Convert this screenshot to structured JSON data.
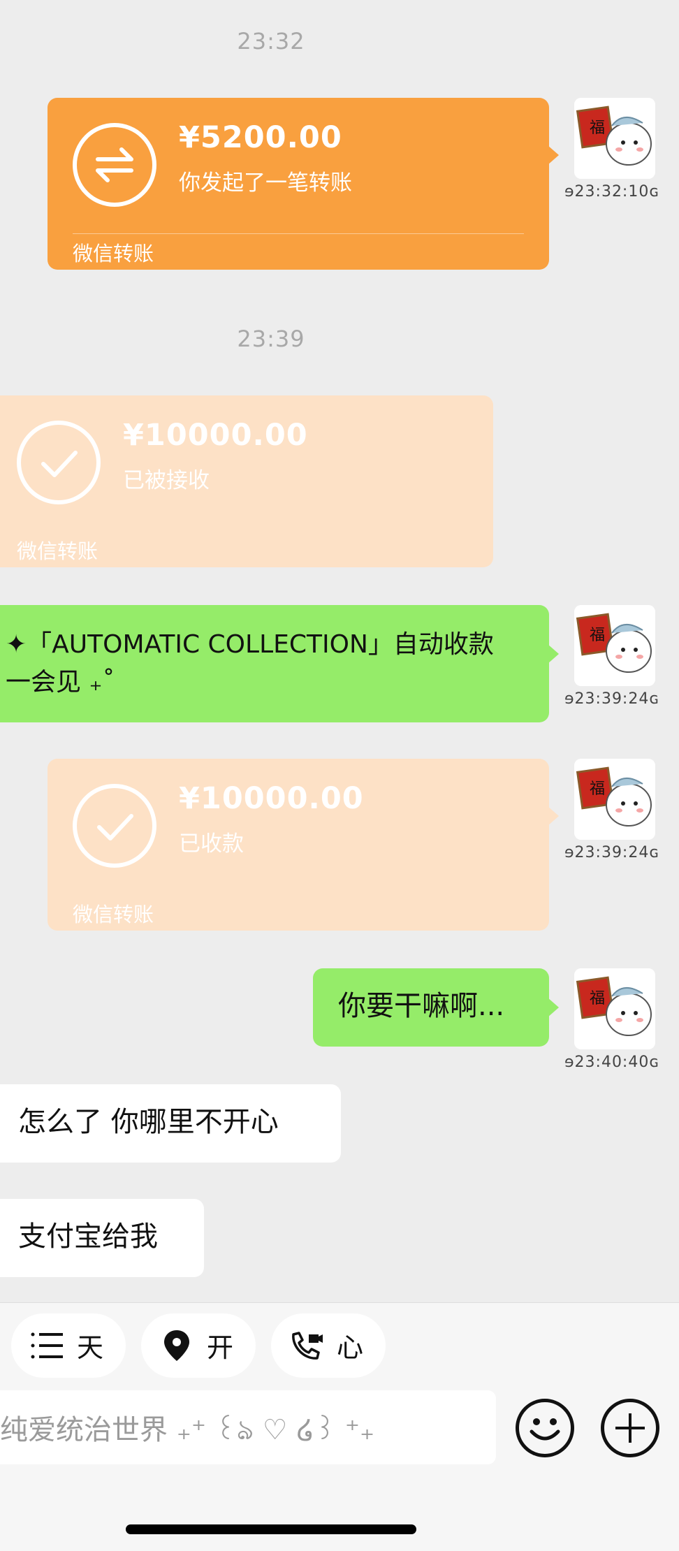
{
  "messages": {
    "time1": "23:32",
    "transfer1": {
      "amount": "¥5200.00",
      "status": "你发起了一笔转账",
      "footer": "微信转账",
      "icon": "transfer-arrows-icon"
    },
    "stamp1": "ɘ23:32:10ɢ",
    "time2": "23:39",
    "transfer2": {
      "amount": "¥10000.00",
      "status": "已被接收",
      "footer": "微信转账",
      "icon": "check-circle-icon"
    },
    "text1_line1": "✦「AUTOMATIC COLLECTION」自动收款",
    "text1_line2": "一会见 ₊˚",
    "stamp2": "ɘ23:39:24ɢ",
    "transfer3": {
      "amount": "¥10000.00",
      "status": "已收款",
      "footer": "微信转账",
      "icon": "check-circle-icon"
    },
    "stamp3": "ɘ23:39:24ɢ",
    "text2": "你要干嘛啊...",
    "stamp4": "ɘ23:40:40ɢ",
    "text3": "怎么了 你哪里不开心",
    "text4": "支付宝给我"
  },
  "quick_actions": [
    {
      "label": "天",
      "icon": "list-icon"
    },
    {
      "label": "开",
      "icon": "location-pin-icon"
    },
    {
      "label": "心",
      "icon": "video-call-icon"
    }
  ],
  "input": {
    "placeholder": "纯爱统治世界 ₊⁺ ꒰ঌ ♡ ໒꒱ ⁺₊"
  },
  "colors": {
    "sent_transfer": "#f9a03f",
    "received_transfer": "#fde1c6",
    "green_bubble": "#95ec69",
    "background": "#ededed"
  }
}
